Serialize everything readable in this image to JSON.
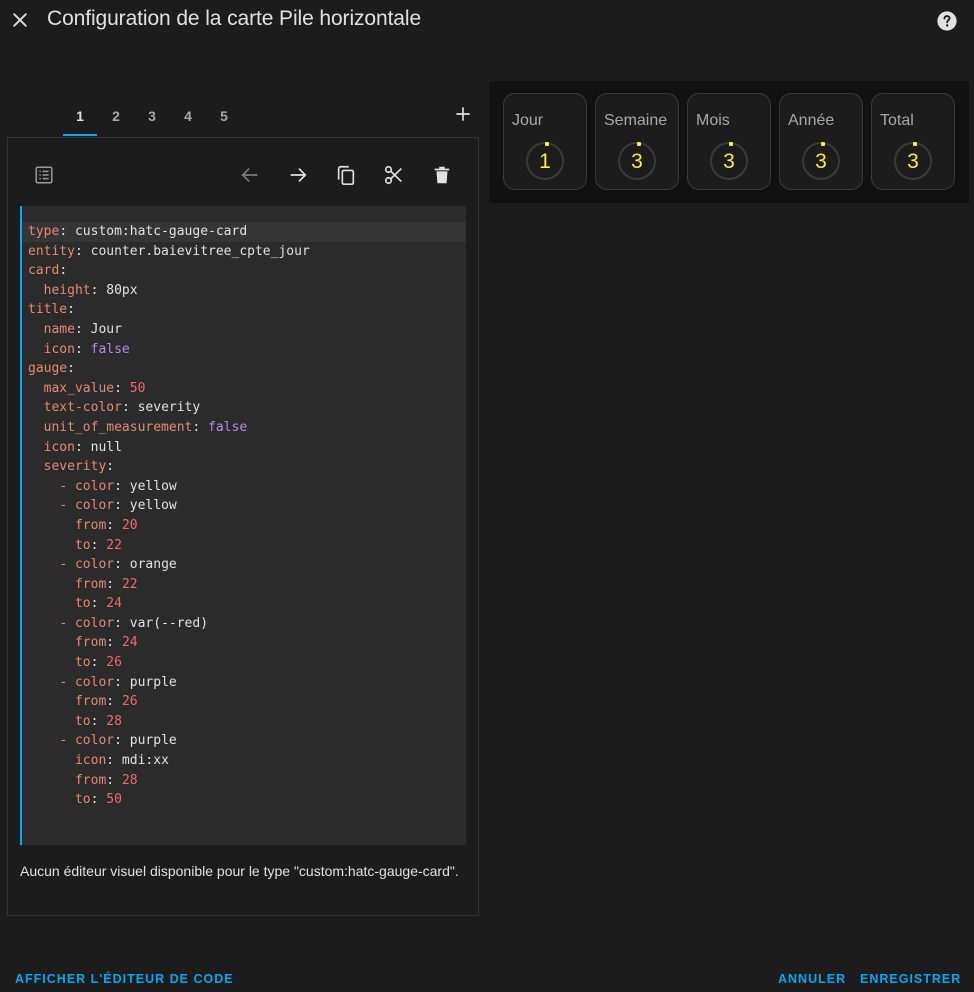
{
  "header": {
    "title": "Configuration de la carte Pile horizontale",
    "close_icon": "close-icon",
    "help_icon": "help-circle-icon"
  },
  "tabs": [
    {
      "label": "1",
      "active": true
    },
    {
      "label": "2",
      "active": false
    },
    {
      "label": "3",
      "active": false
    },
    {
      "label": "4",
      "active": false
    },
    {
      "label": "5",
      "active": false
    }
  ],
  "toolbar": {
    "icons": [
      "list-icon",
      "arrow-left-icon",
      "arrow-right-icon",
      "copy-icon",
      "cut-icon",
      "delete-icon"
    ]
  },
  "editor": {
    "lines": [
      {
        "n": "1",
        "tokens": [
          {
            "c": "k",
            "t": "type"
          },
          {
            "c": "s",
            "t": ": custom:hatc-gauge-card"
          }
        ]
      },
      {
        "n": "2",
        "tokens": [
          {
            "c": "k",
            "t": "entity"
          },
          {
            "c": "s",
            "t": ": counter.baievitree_cpte_jour"
          }
        ]
      },
      {
        "n": "3",
        "tokens": [
          {
            "c": "k",
            "t": "card"
          },
          {
            "c": "s",
            "t": ":"
          }
        ]
      },
      {
        "n": "4",
        "tokens": [
          {
            "c": "s",
            "t": "  "
          },
          {
            "c": "k",
            "t": "height"
          },
          {
            "c": "s",
            "t": ": 80px"
          }
        ]
      },
      {
        "n": "5",
        "tokens": [
          {
            "c": "k",
            "t": "title"
          },
          {
            "c": "s",
            "t": ":"
          }
        ]
      },
      {
        "n": "6",
        "tokens": [
          {
            "c": "s",
            "t": "  "
          },
          {
            "c": "k",
            "t": "name"
          },
          {
            "c": "s",
            "t": ": Jour"
          }
        ]
      },
      {
        "n": "7",
        "tokens": [
          {
            "c": "s",
            "t": "  "
          },
          {
            "c": "k",
            "t": "icon"
          },
          {
            "c": "s",
            "t": ": "
          },
          {
            "c": "b",
            "t": "false"
          }
        ]
      },
      {
        "n": "8",
        "tokens": [
          {
            "c": "k",
            "t": "gauge"
          },
          {
            "c": "s",
            "t": ":"
          }
        ]
      },
      {
        "n": "9",
        "tokens": [
          {
            "c": "s",
            "t": "  "
          },
          {
            "c": "k",
            "t": "max_value"
          },
          {
            "c": "s",
            "t": ": "
          },
          {
            "c": "n",
            "t": "50"
          }
        ]
      },
      {
        "n": "10",
        "tokens": [
          {
            "c": "s",
            "t": "  "
          },
          {
            "c": "k",
            "t": "text-color"
          },
          {
            "c": "s",
            "t": ": severity"
          }
        ]
      },
      {
        "n": "11",
        "tokens": [
          {
            "c": "s",
            "t": "  "
          },
          {
            "c": "k",
            "t": "unit_of_measurement"
          },
          {
            "c": "s",
            "t": ": "
          },
          {
            "c": "b",
            "t": "false"
          }
        ]
      },
      {
        "n": "12",
        "tokens": [
          {
            "c": "s",
            "t": "  "
          },
          {
            "c": "k",
            "t": "icon"
          },
          {
            "c": "s",
            "t": ": null"
          }
        ]
      },
      {
        "n": "13",
        "tokens": [
          {
            "c": "s",
            "t": "  "
          },
          {
            "c": "k",
            "t": "severity"
          },
          {
            "c": "s",
            "t": ":"
          }
        ]
      },
      {
        "n": "14",
        "tokens": [
          {
            "c": "s",
            "t": "    "
          },
          {
            "c": "d",
            "t": "- "
          },
          {
            "c": "k",
            "t": "color"
          },
          {
            "c": "s",
            "t": ": yellow"
          }
        ]
      },
      {
        "n": "15",
        "tokens": [
          {
            "c": "s",
            "t": "    "
          },
          {
            "c": "d",
            "t": "- "
          },
          {
            "c": "k",
            "t": "color"
          },
          {
            "c": "s",
            "t": ": yellow"
          }
        ]
      },
      {
        "n": "16",
        "tokens": [
          {
            "c": "s",
            "t": "      "
          },
          {
            "c": "k",
            "t": "from"
          },
          {
            "c": "s",
            "t": ": "
          },
          {
            "c": "n",
            "t": "20"
          }
        ]
      },
      {
        "n": "17",
        "tokens": [
          {
            "c": "s",
            "t": "      "
          },
          {
            "c": "k",
            "t": "to"
          },
          {
            "c": "s",
            "t": ": "
          },
          {
            "c": "n",
            "t": "22"
          }
        ]
      },
      {
        "n": "18",
        "tokens": [
          {
            "c": "s",
            "t": "    "
          },
          {
            "c": "d",
            "t": "- "
          },
          {
            "c": "k",
            "t": "color"
          },
          {
            "c": "s",
            "t": ": orange"
          }
        ]
      },
      {
        "n": "19",
        "tokens": [
          {
            "c": "s",
            "t": "      "
          },
          {
            "c": "k",
            "t": "from"
          },
          {
            "c": "s",
            "t": ": "
          },
          {
            "c": "n",
            "t": "22"
          }
        ]
      },
      {
        "n": "20",
        "tokens": [
          {
            "c": "s",
            "t": "      "
          },
          {
            "c": "k",
            "t": "to"
          },
          {
            "c": "s",
            "t": ": "
          },
          {
            "c": "n",
            "t": "24"
          }
        ]
      },
      {
        "n": "21",
        "tokens": [
          {
            "c": "s",
            "t": "    "
          },
          {
            "c": "d",
            "t": "- "
          },
          {
            "c": "k",
            "t": "color"
          },
          {
            "c": "s",
            "t": ": var(--red)"
          }
        ]
      },
      {
        "n": "22",
        "tokens": [
          {
            "c": "s",
            "t": "      "
          },
          {
            "c": "k",
            "t": "from"
          },
          {
            "c": "s",
            "t": ": "
          },
          {
            "c": "n",
            "t": "24"
          }
        ]
      },
      {
        "n": "23",
        "tokens": [
          {
            "c": "s",
            "t": "      "
          },
          {
            "c": "k",
            "t": "to"
          },
          {
            "c": "s",
            "t": ": "
          },
          {
            "c": "n",
            "t": "26"
          }
        ]
      },
      {
        "n": "24",
        "tokens": [
          {
            "c": "s",
            "t": "    "
          },
          {
            "c": "d",
            "t": "- "
          },
          {
            "c": "k",
            "t": "color"
          },
          {
            "c": "s",
            "t": ": purple"
          }
        ]
      },
      {
        "n": "25",
        "tokens": [
          {
            "c": "s",
            "t": "      "
          },
          {
            "c": "k",
            "t": "from"
          },
          {
            "c": "s",
            "t": ": "
          },
          {
            "c": "n",
            "t": "26"
          }
        ]
      },
      {
        "n": "26",
        "tokens": [
          {
            "c": "s",
            "t": "      "
          },
          {
            "c": "k",
            "t": "to"
          },
          {
            "c": "s",
            "t": ": "
          },
          {
            "c": "n",
            "t": "28"
          }
        ]
      },
      {
        "n": "27",
        "tokens": [
          {
            "c": "s",
            "t": "    "
          },
          {
            "c": "d",
            "t": "- "
          },
          {
            "c": "k",
            "t": "color"
          },
          {
            "c": "s",
            "t": ": purple"
          }
        ]
      },
      {
        "n": "28",
        "tokens": [
          {
            "c": "s",
            "t": "      "
          },
          {
            "c": "k",
            "t": "icon"
          },
          {
            "c": "s",
            "t": ": mdi:xx"
          }
        ]
      },
      {
        "n": "29",
        "tokens": [
          {
            "c": "s",
            "t": "      "
          },
          {
            "c": "k",
            "t": "from"
          },
          {
            "c": "s",
            "t": ": "
          },
          {
            "c": "n",
            "t": "28"
          }
        ]
      },
      {
        "n": "30",
        "tokens": [
          {
            "c": "s",
            "t": "      "
          },
          {
            "c": "k",
            "t": "to"
          },
          {
            "c": "s",
            "t": ": "
          },
          {
            "c": "n",
            "t": "50"
          }
        ]
      },
      {
        "n": "31",
        "tokens": []
      }
    ],
    "current_line": "1"
  },
  "no_visual_editor_message": "Aucun éditeur visuel disponible pour le type \"custom:hatc-gauge-card\".",
  "preview": {
    "cards": [
      {
        "name": "Jour",
        "value": "1"
      },
      {
        "name": "Semaine",
        "value": "3"
      },
      {
        "name": "Mois",
        "value": "3"
      },
      {
        "name": "Année",
        "value": "3"
      },
      {
        "name": "Total",
        "value": "3"
      }
    ],
    "value_color": "#ffeb3b"
  },
  "footer": {
    "show_code_editor": "AFFICHER L'ÉDITEUR DE CODE",
    "cancel": "ANNULER",
    "save": "ENREGISTRER"
  },
  "colors": {
    "accent": "#03a9f4",
    "background": "#1c1c1c",
    "code_background": "#2b2b2b"
  }
}
